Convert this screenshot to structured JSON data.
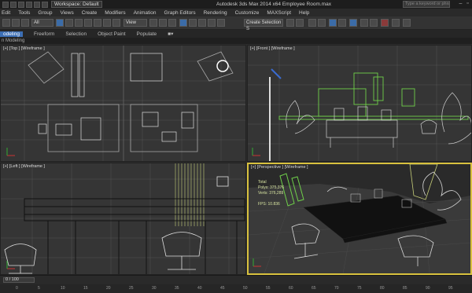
{
  "titlebar": {
    "workspace": "Workspace: Default",
    "title": "Autodesk 3ds Max  2014 x64     Employee Room.max",
    "search_placeholder": "Type a keyword or phrase"
  },
  "menu": [
    "Edit",
    "Tools",
    "Group",
    "Views",
    "Create",
    "Modifiers",
    "Animation",
    "Graph Editors",
    "Rendering",
    "Customize",
    "MAXScript",
    "Help"
  ],
  "toolbar": {
    "selection_filter": "All",
    "reference_coord": "View",
    "named_selection": "Create Selection S"
  },
  "ribbon": {
    "tabs": [
      "odeling",
      "Freeform",
      "Selection",
      "Object Paint",
      "Populate"
    ],
    "sub_label": "n Modeling"
  },
  "viewports": {
    "top": "[+] [Top ] [Wireframe ]",
    "front": "[+] [Front ] [Wireframe ]",
    "left": "[+] [Left ] [Wireframe ]",
    "perspective": "[+] [Perspective ] [Wireframe ]"
  },
  "stats": {
    "total_label": "Total",
    "polys_label": "Polys:",
    "polys_value": "375,376",
    "verts_label": "Verts:",
    "verts_value": "376,289",
    "fps_label": "FPS:",
    "fps_value": "10.836"
  },
  "timeline": {
    "frame": "0 / 100",
    "ticks": [
      "0",
      "5",
      "10",
      "15",
      "20",
      "25",
      "30",
      "35",
      "40",
      "45",
      "50",
      "55",
      "60",
      "65",
      "70",
      "75",
      "80",
      "85",
      "90",
      "95"
    ]
  },
  "colors": {
    "active_border": "#d8c13e",
    "tab_active": "#3c6eb4",
    "selection_green": "#6fd04a",
    "stats_text": "#d6e2a0"
  }
}
